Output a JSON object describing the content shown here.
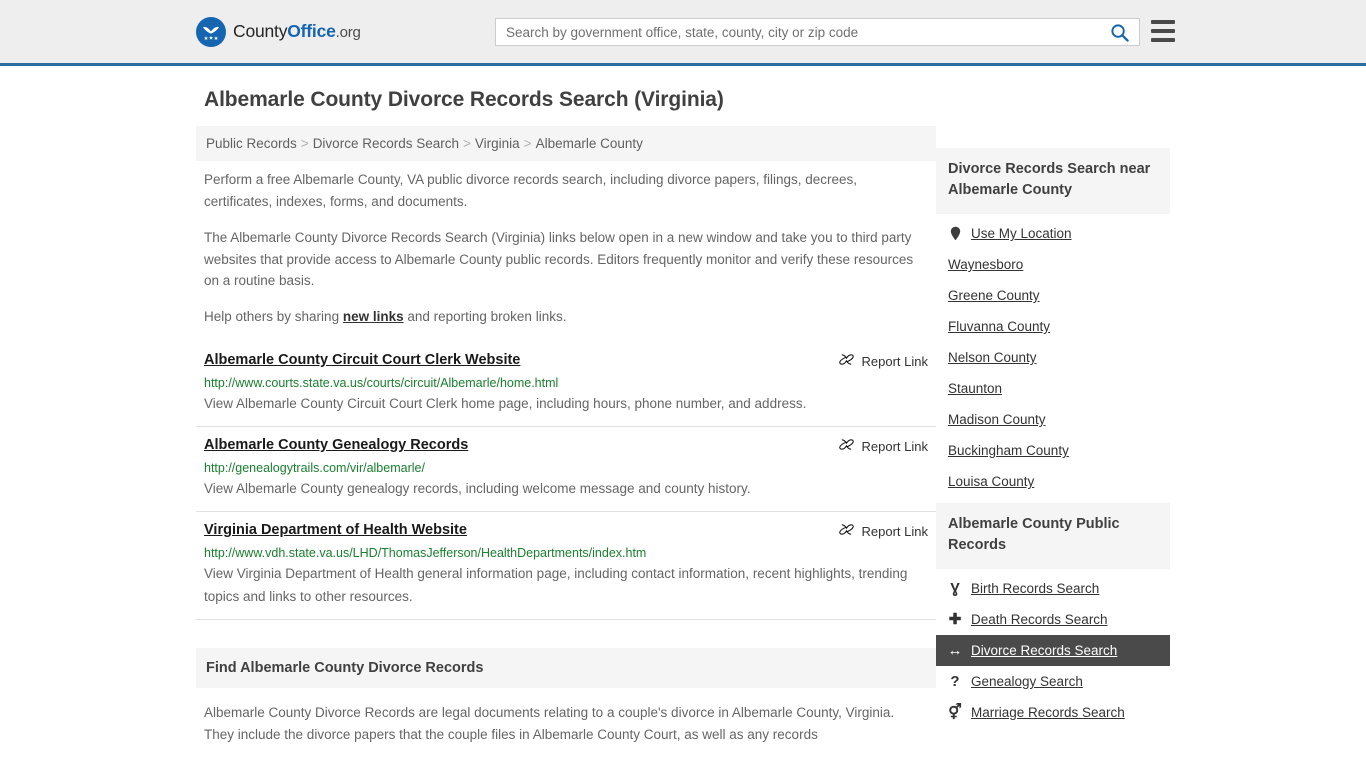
{
  "header": {
    "brand": {
      "part1": "County",
      "part2": "Office",
      "part3": ".org",
      "logo_icon": "eagle-stars-logo"
    },
    "search": {
      "placeholder": "Search by government office, state, county, city or zip code",
      "value": "",
      "search_icon": "search-icon"
    },
    "menu_icon": "hamburger-menu-icon",
    "accent_color": "#2b6ca3"
  },
  "page": {
    "title": "Albemarle County Divorce Records Search (Virginia)",
    "breadcrumb": [
      {
        "label": "Public Records",
        "current": false
      },
      {
        "label": "Divorce Records Search",
        "current": false
      },
      {
        "label": "Virginia",
        "current": false
      },
      {
        "label": "Albemarle County",
        "current": true
      }
    ],
    "breadcrumb_separator": ">",
    "intro": [
      "Perform a free Albemarle County, VA public divorce records search, including divorce papers, filings, decrees, certificates, indexes, forms, and documents.",
      "The Albemarle County Divorce Records Search (Virginia) links below open in a new window and take you to third party websites that provide access to Albemarle County public records. Editors frequently monitor and verify these resources on a routine basis."
    ],
    "help_prefix": "Help others by sharing ",
    "help_link": "new links",
    "help_suffix": " and reporting broken links."
  },
  "results": {
    "report_label": "Report Link",
    "report_icon": "broken-link-icon",
    "items": [
      {
        "title": "Albemarle County Circuit Court Clerk Website",
        "url": "http://www.courts.state.va.us/courts/circuit/Albemarle/home.html",
        "description": "View Albemarle County Circuit Court Clerk home page, including hours, phone number, and address."
      },
      {
        "title": "Albemarle County Genealogy Records",
        "url": "http://genealogytrails.com/vir/albemarle/",
        "description": "View Albemarle County genealogy records, including welcome message and county history."
      },
      {
        "title": "Virginia Department of Health Website",
        "url": "http://www.vdh.state.va.us/LHD/ThomasJefferson/HealthDepartments/index.htm",
        "description": "View Virginia Department of Health general information page, including contact information, recent highlights, trending topics and links to other resources."
      }
    ]
  },
  "find_section": {
    "heading": "Find Albemarle County Divorce Records",
    "body": "Albemarle County Divorce Records are legal documents relating to a couple's divorce in Albemarle County, Virginia. They include the divorce papers that the couple files in Albemarle County Court, as well as any records"
  },
  "sidebar": {
    "nearby": {
      "heading": "Divorce Records Search near Albemarle County",
      "items": [
        {
          "label": "Use My Location",
          "icon": "map-pin-icon"
        },
        {
          "label": "Waynesboro",
          "icon": ""
        },
        {
          "label": "Greene County",
          "icon": ""
        },
        {
          "label": "Fluvanna County",
          "icon": ""
        },
        {
          "label": "Nelson County",
          "icon": ""
        },
        {
          "label": "Staunton",
          "icon": ""
        },
        {
          "label": "Madison County",
          "icon": ""
        },
        {
          "label": "Buckingham County",
          "icon": ""
        },
        {
          "label": "Louisa County",
          "icon": ""
        }
      ]
    },
    "public_records": {
      "heading": "Albemarle County Public Records",
      "items": [
        {
          "label": "Birth Records Search",
          "icon": "baby-icon",
          "glyph": "Ɣ",
          "active": false
        },
        {
          "label": "Death Records Search",
          "icon": "cross-icon",
          "glyph": "✚",
          "active": false
        },
        {
          "label": "Divorce Records Search",
          "icon": "left-right-arrow-icon",
          "glyph": "↔",
          "active": true
        },
        {
          "label": "Genealogy Search",
          "icon": "question-mark-icon",
          "glyph": "?",
          "active": false
        },
        {
          "label": "Marriage Records Search",
          "icon": "male-female-icon",
          "glyph": "⚥",
          "active": false
        }
      ]
    }
  }
}
